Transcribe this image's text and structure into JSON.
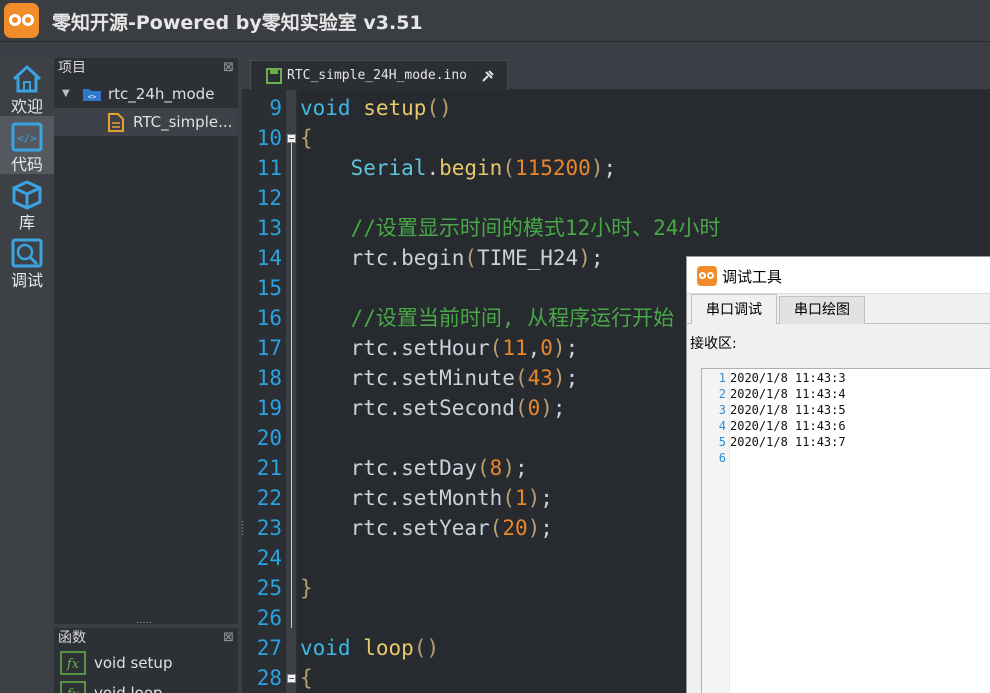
{
  "app": {
    "title": "零知开源-Powered by零知实验室 v3.51"
  },
  "activity_bar": {
    "items": [
      {
        "label": "欢迎",
        "icon": "home-icon"
      },
      {
        "label": "代码",
        "icon": "code-icon"
      },
      {
        "label": "库",
        "icon": "cube-icon"
      },
      {
        "label": "调试",
        "icon": "debug-icon"
      }
    ]
  },
  "project_panel": {
    "title": "项目",
    "close": "⊠",
    "project_name": "rtc_24h_mode",
    "file_name": "RTC_simple..."
  },
  "function_panel": {
    "title": "函数",
    "close": "⊠",
    "items": [
      "void setup",
      "void loop"
    ]
  },
  "editor": {
    "tab_label": "RTC_simple_24H_mode.ino",
    "lines": [
      {
        "n": "9",
        "tokens": [
          [
            "kw",
            "void"
          ],
          [
            "sp",
            " "
          ],
          [
            "fn",
            "setup"
          ],
          [
            "pn",
            "()"
          ]
        ]
      },
      {
        "n": "10",
        "tokens": [
          [
            "pn",
            "{"
          ]
        ]
      },
      {
        "n": "11",
        "tokens": [
          [
            "sp",
            "    "
          ],
          [
            "cls",
            "Serial"
          ],
          [
            "obj",
            "."
          ],
          [
            "fn",
            "begin"
          ],
          [
            "pn",
            "("
          ],
          [
            "num",
            "115200"
          ],
          [
            "pn",
            ")"
          ],
          [
            "obj",
            ";"
          ]
        ]
      },
      {
        "n": "12",
        "tokens": []
      },
      {
        "n": "13",
        "tokens": [
          [
            "sp",
            "    "
          ],
          [
            "cm",
            "//设置显示时间的模式12小时、24小时"
          ]
        ]
      },
      {
        "n": "14",
        "tokens": [
          [
            "sp",
            "    "
          ],
          [
            "obj",
            "rtc.begin"
          ],
          [
            "pn",
            "("
          ],
          [
            "obj",
            "TIME_H24"
          ],
          [
            "pn",
            ")"
          ],
          [
            "obj",
            ";"
          ]
        ]
      },
      {
        "n": "15",
        "tokens": []
      },
      {
        "n": "16",
        "tokens": [
          [
            "sp",
            "    "
          ],
          [
            "cm",
            "//设置当前时间, 从程序运行开始"
          ]
        ]
      },
      {
        "n": "17",
        "tokens": [
          [
            "sp",
            "    "
          ],
          [
            "obj",
            "rtc.setHour"
          ],
          [
            "pn",
            "("
          ],
          [
            "num",
            "11"
          ],
          [
            "obj",
            ","
          ],
          [
            "num",
            "0"
          ],
          [
            "pn",
            ")"
          ],
          [
            "obj",
            ";"
          ]
        ]
      },
      {
        "n": "18",
        "tokens": [
          [
            "sp",
            "    "
          ],
          [
            "obj",
            "rtc.setMinute"
          ],
          [
            "pn",
            "("
          ],
          [
            "num",
            "43"
          ],
          [
            "pn",
            ")"
          ],
          [
            "obj",
            ";"
          ]
        ]
      },
      {
        "n": "19",
        "tokens": [
          [
            "sp",
            "    "
          ],
          [
            "obj",
            "rtc.setSecond"
          ],
          [
            "pn",
            "("
          ],
          [
            "num",
            "0"
          ],
          [
            "pn",
            ")"
          ],
          [
            "obj",
            ";"
          ]
        ]
      },
      {
        "n": "20",
        "tokens": []
      },
      {
        "n": "21",
        "tokens": [
          [
            "sp",
            "    "
          ],
          [
            "obj",
            "rtc.setDay"
          ],
          [
            "pn",
            "("
          ],
          [
            "num",
            "8"
          ],
          [
            "pn",
            ")"
          ],
          [
            "obj",
            ";"
          ]
        ]
      },
      {
        "n": "22",
        "tokens": [
          [
            "sp",
            "    "
          ],
          [
            "obj",
            "rtc.setMonth"
          ],
          [
            "pn",
            "("
          ],
          [
            "num",
            "1"
          ],
          [
            "pn",
            ")"
          ],
          [
            "obj",
            ";"
          ]
        ]
      },
      {
        "n": "23",
        "tokens": [
          [
            "sp",
            "    "
          ],
          [
            "obj",
            "rtc.setYear"
          ],
          [
            "pn",
            "("
          ],
          [
            "num",
            "20"
          ],
          [
            "pn",
            ")"
          ],
          [
            "obj",
            ";"
          ]
        ]
      },
      {
        "n": "24",
        "tokens": []
      },
      {
        "n": "25",
        "tokens": [
          [
            "pn",
            "}"
          ]
        ]
      },
      {
        "n": "26",
        "tokens": []
      },
      {
        "n": "27",
        "tokens": [
          [
            "kw",
            "void"
          ],
          [
            "sp",
            " "
          ],
          [
            "fn",
            "loop"
          ],
          [
            "pn",
            "()"
          ]
        ]
      },
      {
        "n": "28",
        "tokens": [
          [
            "pn",
            "{"
          ]
        ]
      }
    ]
  },
  "debug_window": {
    "title": "调试工具",
    "tabs": [
      "串口调试",
      "串口绘图"
    ],
    "receive_label": "接收区:",
    "receive_lines": [
      {
        "n": "1",
        "text": "2020/1/8 11:43:3"
      },
      {
        "n": "2",
        "text": "2020/1/8 11:43:4"
      },
      {
        "n": "3",
        "text": "2020/1/8 11:43:5"
      },
      {
        "n": "4",
        "text": "2020/1/8 11:43:6"
      },
      {
        "n": "5",
        "text": "2020/1/8 11:43:7"
      },
      {
        "n": "6",
        "text": ""
      }
    ]
  },
  "colors": {
    "accent_orange": "#f08c2a",
    "line_number_blue": "#2ba3e0"
  }
}
